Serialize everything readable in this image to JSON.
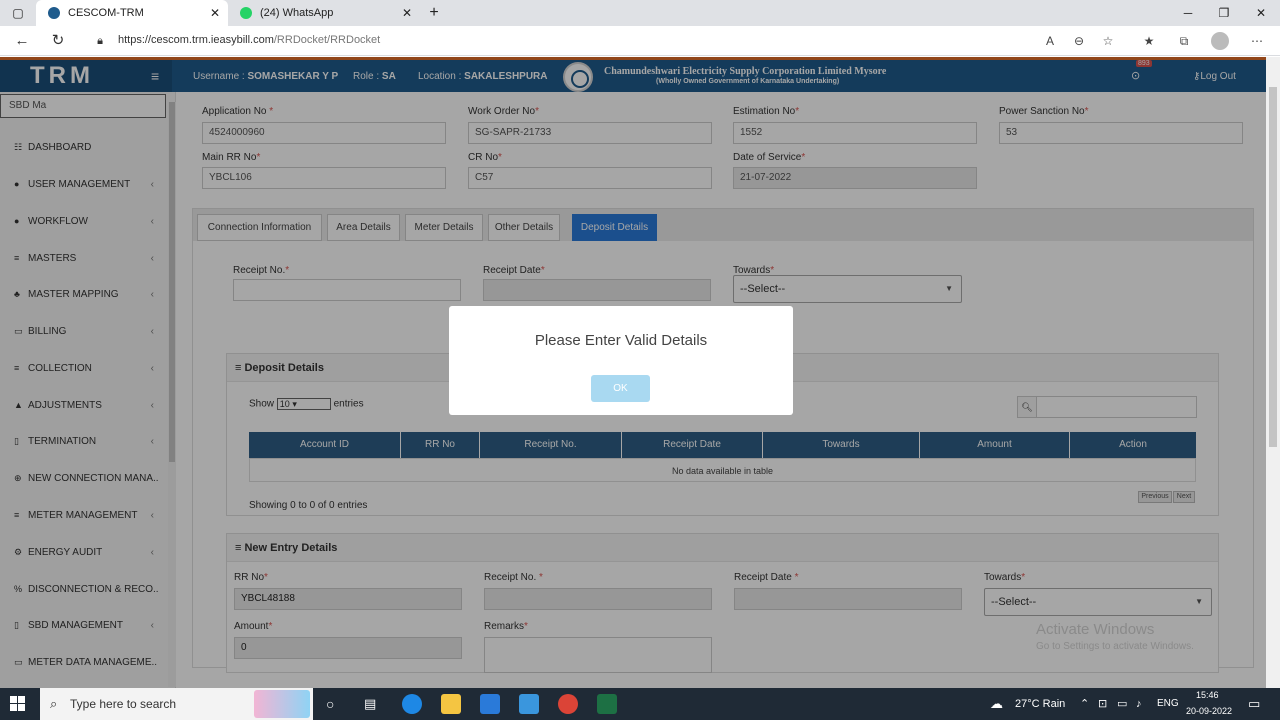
{
  "browser": {
    "tabs": [
      {
        "title": "CESCOM-TRM",
        "active": true
      },
      {
        "title": "(24) WhatsApp",
        "active": false
      }
    ],
    "url_host": "https://cescom.trm.ieasybill.com",
    "url_path": "/RRDocket/RRDocket"
  },
  "header": {
    "logo": "TRM",
    "username_label": "Username :",
    "username": "SOMASHEKAR Y P",
    "role_label": "Role :",
    "role": "SA",
    "location_label": "Location :",
    "location": "SAKALESHPURA",
    "corp_name": "Chamundeshwari Electricity Supply Corporation Limited Mysore",
    "corp_sub": "(Wholly Owned Government of Karnataka Undertaking)",
    "notif_count": "893",
    "logout": "Log Out"
  },
  "sidebar": {
    "search_value": "SBD Ma",
    "items": [
      {
        "label": "DASHBOARD",
        "icon": "dashboard-icon",
        "glyph": "☷",
        "chev": false
      },
      {
        "label": "USER MANAGEMENT",
        "icon": "user-icon",
        "glyph": "●",
        "chev": true
      },
      {
        "label": "WORKFLOW",
        "icon": "user-icon",
        "glyph": "●",
        "chev": true
      },
      {
        "label": "MASTERS",
        "icon": "list-icon",
        "glyph": "≡",
        "chev": true
      },
      {
        "label": "MASTER MAPPING",
        "icon": "sitemap-icon",
        "glyph": "♣",
        "chev": true
      },
      {
        "label": "BILLING",
        "icon": "monitor-icon",
        "glyph": "▭",
        "chev": true
      },
      {
        "label": "COLLECTION",
        "icon": "list-icon",
        "glyph": "≡",
        "chev": true
      },
      {
        "label": "ADJUSTMENTS",
        "icon": "road-icon",
        "glyph": "▲",
        "chev": true
      },
      {
        "label": "TERMINATION",
        "icon": "trash-icon",
        "glyph": "▯",
        "chev": true
      },
      {
        "label": "NEW CONNECTION MANA..",
        "icon": "plus-circle-icon",
        "glyph": "⊕",
        "chev": true
      },
      {
        "label": "METER MANAGEMENT",
        "icon": "list-icon",
        "glyph": "≡",
        "chev": true
      },
      {
        "label": "ENERGY AUDIT",
        "icon": "cogs-icon",
        "glyph": "⚙",
        "chev": true
      },
      {
        "label": "DISCONNECTION & RECO..",
        "icon": "percent-icon",
        "glyph": "%",
        "chev": true
      },
      {
        "label": "SBD MANAGEMENT",
        "icon": "mobile-icon",
        "glyph": "▯",
        "chev": true
      },
      {
        "label": "METER DATA MANAGEME..",
        "icon": "monitor-icon",
        "glyph": "▭",
        "chev": true
      }
    ]
  },
  "form": {
    "application_no_label": "Application No",
    "application_no": "4524000960",
    "work_order_label": "Work Order No",
    "work_order": "SG-SAPR-21733",
    "estimation_label": "Estimation No",
    "estimation": "1552",
    "power_sanction_label": "Power Sanction No",
    "power_sanction": "53",
    "main_rr_label": "Main RR No",
    "main_rr": "YBCL106",
    "cr_no_label": "CR No",
    "cr_no": "C57",
    "date_of_service_label": "Date of Service",
    "date_of_service": "21-07-2022"
  },
  "tabs": [
    {
      "label": "Connection Information"
    },
    {
      "label": "Area Details"
    },
    {
      "label": "Meter Details"
    },
    {
      "label": "Other Details"
    },
    {
      "label": "Deposit Details"
    }
  ],
  "deposit": {
    "receipt_no_label": "Receipt No.",
    "receipt_date_label": "Receipt Date",
    "towards_label": "Towards",
    "select_placeholder": "--Select--",
    "panel_title": "Deposit Details",
    "show_label": "Show",
    "entries_value": "10",
    "entries_label": "entries",
    "columns": [
      "Account ID",
      "RR No",
      "Receipt No.",
      "Receipt Date",
      "Towards",
      "Amount",
      "Action"
    ],
    "empty_text": "No data available in table",
    "showing_text": "Showing 0 to 0 of 0 entries",
    "previous": "Previous",
    "next": "Next"
  },
  "new_entry": {
    "panel_title": "New Entry Details",
    "rr_no_label": "RR No",
    "rr_no": "YBCL48188",
    "receipt_no_label": "Receipt No.",
    "receipt_date_label": "Receipt Date",
    "towards_label": "Towards",
    "select_placeholder": "--Select--",
    "amount_label": "Amount",
    "amount": "0",
    "remarks_label": "Remarks"
  },
  "watermark": {
    "line1": "Activate Windows",
    "line2": "Go to Settings to activate Windows."
  },
  "modal": {
    "message": "Please Enter Valid Details",
    "ok": "OK"
  },
  "taskbar": {
    "search_placeholder": "Type here to search",
    "weather": "27°C  Rain",
    "lang": "ENG",
    "time": "15:46",
    "date": "20-09-2022"
  }
}
